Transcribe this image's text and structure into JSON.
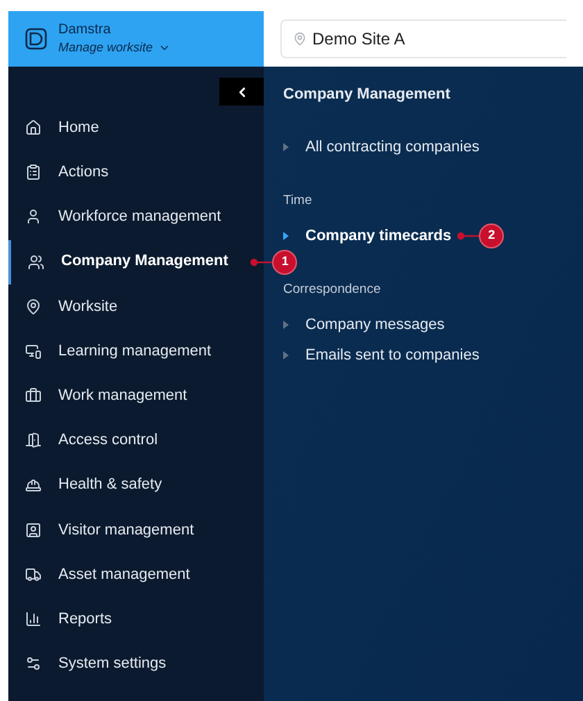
{
  "brand": {
    "name": "Damstra",
    "subtitle": "Manage worksite"
  },
  "site_search": {
    "value": "Demo Site A"
  },
  "sidebar": {
    "items": [
      {
        "label": "Home",
        "selected": false
      },
      {
        "label": "Actions",
        "selected": false
      },
      {
        "label": "Workforce management",
        "selected": false
      },
      {
        "label": "Company Management",
        "selected": true,
        "callout": "1"
      },
      {
        "label": "Worksite",
        "selected": false
      },
      {
        "label": "Learning management",
        "selected": false
      },
      {
        "label": "Work management",
        "selected": false
      },
      {
        "label": "Access control",
        "selected": false
      },
      {
        "label": "Health & safety",
        "selected": false
      },
      {
        "label": "Visitor management",
        "selected": false
      },
      {
        "label": "Asset management",
        "selected": false
      },
      {
        "label": "Reports",
        "selected": false
      },
      {
        "label": "System settings",
        "selected": false
      }
    ]
  },
  "panel": {
    "title": "Company Management",
    "sections": [
      {
        "links": [
          {
            "label": "All contracting companies",
            "selected": false
          }
        ]
      },
      {
        "heading": "Time",
        "links": [
          {
            "label": "Company timecards",
            "selected": true,
            "callout": "2"
          }
        ]
      },
      {
        "heading": "Correspondence",
        "links": [
          {
            "label": "Company messages",
            "selected": false
          },
          {
            "label": "Emails sent to companies",
            "selected": false
          }
        ]
      }
    ]
  }
}
